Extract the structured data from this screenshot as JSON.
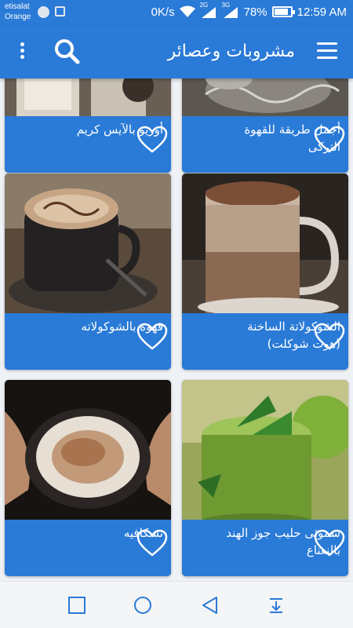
{
  "status_bar": {
    "carrier_line1": "etisalat",
    "carrier_line2": "Orange",
    "network_speed": "0K/s",
    "signal1_label": "2G",
    "signal2_label": "3G",
    "battery_percent": "78%",
    "battery_level": 0.78,
    "time": "12:59 AM"
  },
  "app_bar": {
    "title": "مشروبات وعصائر",
    "icons": {
      "menu": "more-vert-icon",
      "search": "search-icon",
      "drawer": "hamburger-menu-icon"
    }
  },
  "cards": [
    {
      "title": "أجمل طريقة للقهوة التركى",
      "favorite_icon": "heart-outline-icon"
    },
    {
      "title": "أوريو بالآيس كريم",
      "favorite_icon": "heart-outline-icon"
    },
    {
      "title": "الشوكولاتة الساخنة (هوت شوكلت)",
      "favorite_icon": "heart-outline-icon"
    },
    {
      "title": "قهوة بالشوكولاته",
      "favorite_icon": "heart-outline-icon"
    },
    {
      "title": "سموثى حليب جوز الهند بالنعناع",
      "favorite_icon": "heart-outline-icon"
    },
    {
      "title": "نسكافيه",
      "favorite_icon": "heart-outline-icon"
    }
  ],
  "nav_bar": {
    "icons": [
      "recent-apps-icon",
      "home-icon",
      "back-icon",
      "notification-pull-icon"
    ]
  },
  "colors": {
    "primary": "#2a7ad7",
    "background": "#eef1f5"
  }
}
